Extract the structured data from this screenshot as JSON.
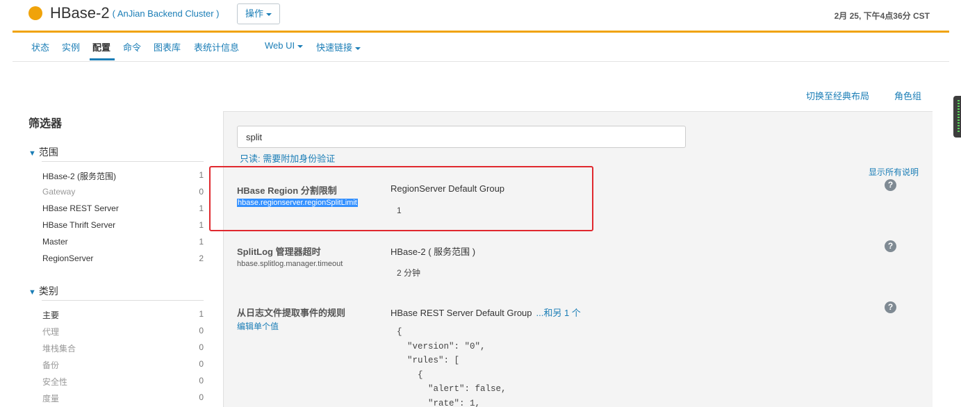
{
  "service": {
    "status_color": "#f0a30a",
    "name": "HBase-2",
    "cluster": "( AnJian Backend Cluster )",
    "actions_label": "操作",
    "timestamp": "2月 25, 下午4点36分 CST"
  },
  "nav": {
    "tabs": [
      {
        "label": "状态"
      },
      {
        "label": "实例"
      },
      {
        "label": "配置",
        "active": true
      },
      {
        "label": "命令"
      },
      {
        "label": "图表库"
      },
      {
        "label": "表统计信息"
      },
      {
        "label": "Web UI"
      },
      {
        "label": "快速链接"
      }
    ]
  },
  "links": {
    "classic_layout": "切换至经典布局",
    "role_groups": "角色组"
  },
  "filters": {
    "title": "筛选器",
    "scope": {
      "heading": "范围",
      "items": [
        {
          "label": "HBase-2 (服务范围)",
          "count": "1"
        },
        {
          "label": "Gateway",
          "count": "0"
        },
        {
          "label": "HBase REST Server",
          "count": "1"
        },
        {
          "label": "HBase Thrift Server",
          "count": "1"
        },
        {
          "label": "Master",
          "count": "1"
        },
        {
          "label": "RegionServer",
          "count": "2"
        }
      ]
    },
    "category": {
      "heading": "类别",
      "items": [
        {
          "label": "主要",
          "count": "1"
        },
        {
          "label": "代理",
          "count": "0"
        },
        {
          "label": "堆栈集合",
          "count": "0"
        },
        {
          "label": "备份",
          "count": "0"
        },
        {
          "label": "安全性",
          "count": "0"
        },
        {
          "label": "度量",
          "count": "0"
        }
      ]
    }
  },
  "search": {
    "value": "split"
  },
  "readonly_notice": "只读: 需要附加身份验证",
  "show_all_descriptions": "显示所有说明",
  "properties": [
    {
      "name": "HBase Region 分割限制",
      "key": "hbase.regionserver.regionSplitLimit",
      "scope": "RegionServer Default Group",
      "value": "1"
    },
    {
      "name": "SplitLog 管理器超时",
      "key": "hbase.splitlog.manager.timeout",
      "scope": "HBase-2 ( 服务范围 )",
      "value": "2 分钟"
    },
    {
      "name": "从日志文件提取事件的规则",
      "edit_label": "编辑单个值",
      "scope": "HBase REST Server Default Group",
      "scope_more": "...和另 1 个",
      "value": "{\n  \"version\": \"0\",\n  \"rules\": [\n    {\n      \"alert\": false,\n      \"rate\": 1,"
    }
  ],
  "colors": {
    "accent": "#1a7db6",
    "highlight_box": "#e0282e"
  }
}
